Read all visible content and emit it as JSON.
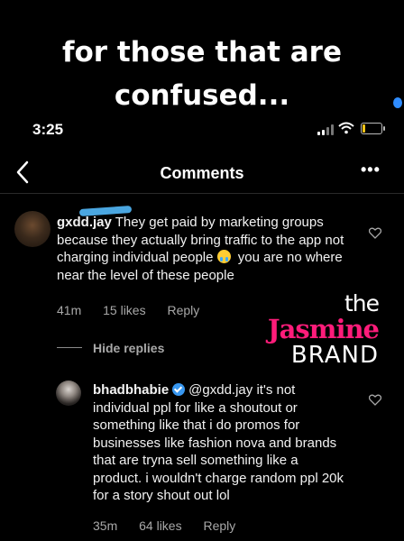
{
  "caption": {
    "line1": "for those that are",
    "line2": "confused..."
  },
  "status_bar": {
    "time": "3:25"
  },
  "header": {
    "title": "Comments",
    "back_icon": "chevron-left-icon",
    "more_icon": "more-horizontal-icon"
  },
  "comment1": {
    "username": "gxdd.jay",
    "text_part1": " They get paid by marketing groups because they actually bring traffic to the app not charging individual people",
    "text_part2": " you are no where near the level of these people",
    "time": "41m",
    "likes": "15 likes",
    "reply": "Reply"
  },
  "hide_replies": "Hide replies",
  "comment2": {
    "username": "bhadbhabie",
    "mention": "@gxdd.jay",
    "text": " it's not individual ppl for like a shoutout or something like that i do promos for businesses like fashion nova and brands that are tryna sell something like a product. i wouldn't charge random ppl 20k for a story shout out lol",
    "time": "35m",
    "likes": "64 likes",
    "reply": "Reply"
  },
  "watermark": {
    "line1": "the",
    "line2": "Jasmine",
    "line3": "BRAND"
  },
  "colors": {
    "background": "#000000",
    "verified": "#3897f0",
    "watermark_pink": "#ff1c7a",
    "muted_text": "#a8a8a8"
  }
}
